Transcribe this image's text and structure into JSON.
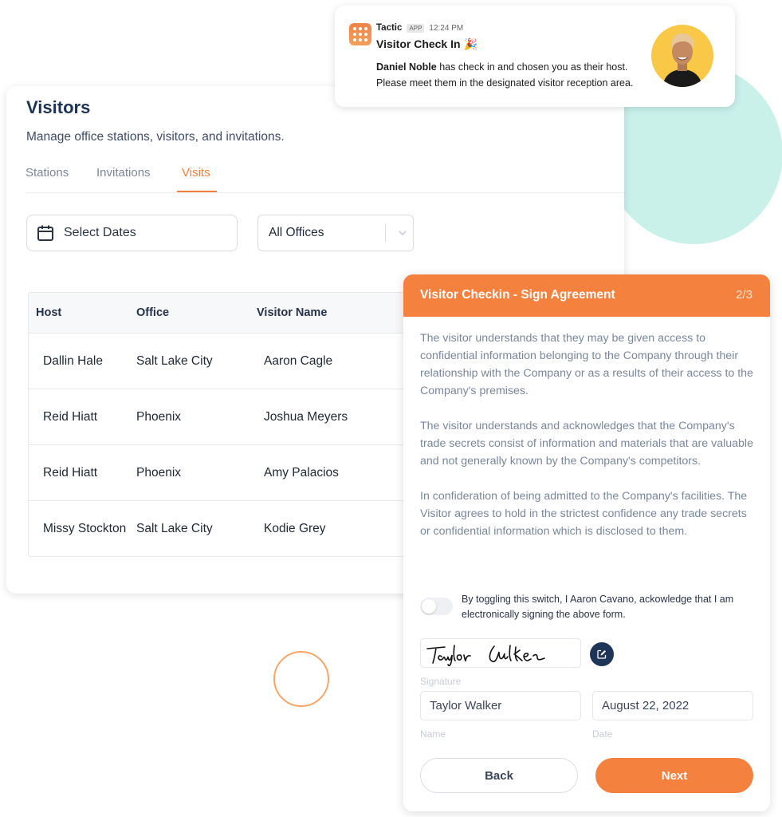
{
  "notification": {
    "app_name": "Tactic",
    "app_badge": "APP",
    "time": "12:24 PM",
    "title": "Visitor Check In",
    "title_emoji": "🎉",
    "visitor_name": "Daniel Noble",
    "body_line1_rest": " has check in and chosen you as their host.",
    "body_line2": "Please meet them in the designated visitor reception area.",
    "avatar_bg": "#f8c846"
  },
  "visitors": {
    "title": "Visitors",
    "subtitle": "Manage office stations, visitors, and invitations.",
    "tabs": [
      {
        "label": "Stations",
        "active": false
      },
      {
        "label": "Invitations",
        "active": false
      },
      {
        "label": "Visits",
        "active": true
      }
    ],
    "date_filter": {
      "label": "Select Dates",
      "icon": "calendar-icon"
    },
    "office_select": {
      "value": "All Offices",
      "icon": "chevron-down-icon"
    },
    "table": {
      "columns": [
        "Host",
        "Office",
        "Visitor Name"
      ],
      "rows": [
        [
          "Dallin Hale",
          "Salt Lake City",
          "Aaron Cagle"
        ],
        [
          "Reid Hiatt",
          "Phoenix",
          "Joshua Meyers"
        ],
        [
          "Reid Hiatt",
          "Phoenix",
          "Amy Palacios"
        ],
        [
          "Missy Stockton",
          "Salt Lake City",
          "Kodie Grey"
        ]
      ]
    }
  },
  "checkin": {
    "title": "Visitor Checkin  - Sign Agreement",
    "step": "2/3",
    "paragraphs": [
      "The visitor understands that they may be given access to confidential information belonging to the Company through their relationship with the Company or as a results of their access to the Company's premises.",
      "The visitor understands and acknowledges that the Company's trade secrets consist of information and materials that are valuable and not generally known by the Company's competitors.",
      "In confideration of being admitted to the Company's facilities. The Visitor agrees to hold in the strictest confidence any trade secrets or confidential information which is disclosed to them."
    ],
    "toggle": {
      "on": false,
      "label": "By toggling this switch, I Aaron Cavano, ackowledge that I am electronically signing the above form."
    },
    "signature_label": "Signature",
    "name_value": "Taylor Walker",
    "name_label": "Name",
    "date_value": "August 22, 2022",
    "date_label": "Date",
    "back_label": "Back",
    "next_label": "Next",
    "accent": "#f5813f"
  }
}
